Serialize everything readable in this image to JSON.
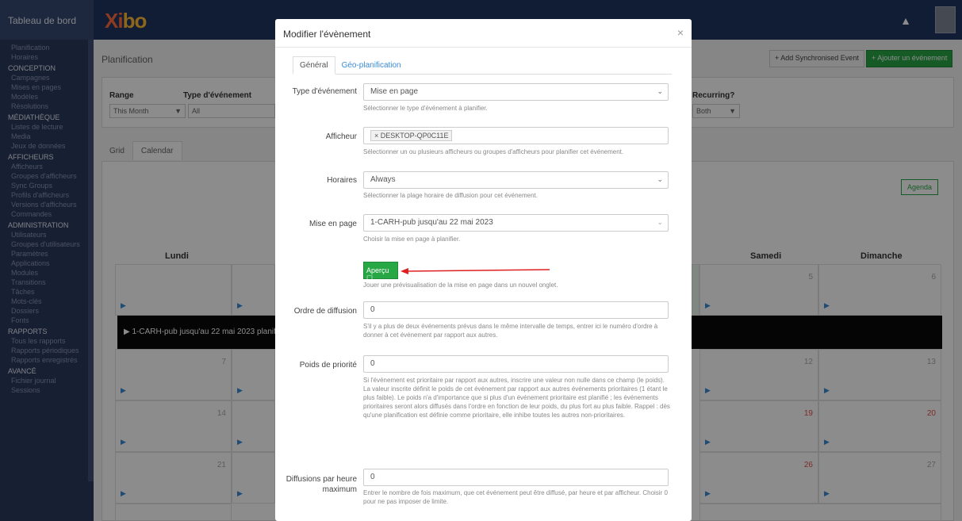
{
  "sidebar": {
    "brand": "Tableau de bord",
    "top_items": [
      "Planification",
      "Horaires"
    ],
    "sections": [
      {
        "title": "CONCEPTION",
        "items": [
          "Campagnes",
          "Mises en pages",
          "Modèles",
          "Résolutions"
        ]
      },
      {
        "title": "MÉDIATHÈQUE",
        "items": [
          "Listes de lecture",
          "Media",
          "Jeux de données"
        ]
      },
      {
        "title": "AFFICHEURS",
        "items": [
          "Afficheurs",
          "Groupes d'afficheurs",
          "Sync Groups",
          "Profils d'afficheurs",
          "Versions d'afficheurs",
          "Commandes"
        ]
      },
      {
        "title": "ADMINISTRATION",
        "items": [
          "Utilisateurs",
          "Groupes d'utilisateurs",
          "Paramètres",
          "Applications",
          "Modules",
          "Transitions",
          "Tâches",
          "Mots-clés",
          "Dossiers",
          "Fonts"
        ]
      },
      {
        "title": "RAPPORTS",
        "items": [
          "Tous les rapports",
          "Rapports périodiques",
          "Rapports enregistrés"
        ]
      },
      {
        "title": "AVANCÉ",
        "items": [
          "Fichier journal",
          "Sessions"
        ]
      }
    ]
  },
  "topbar": {
    "logo_a": "Xi",
    "logo_b": "bo",
    "bell_icon": "bell-icon",
    "avatar_icon": "user-avatar"
  },
  "page": {
    "title": "Planification",
    "sync_button": "+ Add Synchronised Event",
    "add_button": "+ Ajouter un événement",
    "filters": {
      "range_label": "Range",
      "range_value": "This Month",
      "type_label": "Type d'événement",
      "type_value": "All",
      "recurring_label": "Recurring?",
      "recurring_value": "Both"
    },
    "view_tabs": [
      "Grid",
      "Calendar"
    ],
    "agenda_button": "Agenda",
    "day_headers": {
      "mon": "Lundi",
      "sat": "Samedi",
      "sun": "Dimanche"
    },
    "dates": {
      "r1_sat": "5",
      "r1_sun": "6",
      "r2_mon": "7",
      "r2_sat": "12",
      "r2_sun": "13",
      "r3_mon": "14",
      "r3_sat": "19",
      "r3_sun": "20",
      "r4_mon": "21",
      "r4_sat": "26",
      "r4_sun": "27"
    },
    "event_bar": "1-CARH-pub jusqu'au 22 mai 2023 planif"
  },
  "modal": {
    "title": "Modifier l'évènement",
    "close_icon": "×",
    "tabs": [
      "Général",
      "Géo-planification"
    ],
    "fields": {
      "type": {
        "label": "Type d'événement",
        "value": "Mise en page",
        "help": "Sélectionner le type d'événement à planifier."
      },
      "display": {
        "label": "Afficheur",
        "tag": "× DESKTOP-QP0C11E",
        "help": "Sélectionner un ou plusieurs afficheurs ou groupes d'afficheurs pour planifier cet événement."
      },
      "dayparting": {
        "label": "Horaires",
        "value": "Always",
        "help": "Sélectionner la plage horaire de diffusion pour cet événement."
      },
      "layout": {
        "label": "Mise en page",
        "value": "1-CARH-pub jusqu'au 22 mai 2023",
        "help": "Choisir la mise en page à planifier."
      },
      "preview": {
        "button": "Aperçu ☐",
        "help": "Jouer une prévisualisation de la mise en page dans un nouvel onglet."
      },
      "display_order": {
        "label": "Ordre de diffusion",
        "value": "0",
        "help": "S'il y a plus de deux événements prévus dans le même intervalle de temps, entrer ici le numéro d'ordre à donner à cet événement par rapport aux autres."
      },
      "priority": {
        "label": "Poids de priorité",
        "value": "0",
        "help": "Si l'événement est prioritaire par rapport aux autres, inscrire une valeur non nulle dans ce champ (le poids). La valeur inscrite définit le poids de cet événement par rapport aux autres événements prioritaires (1 étant le plus faible). Le poids n'a d'importance que si plus d'un événement prioritaire est planifié ; les événements prioritaires seront alors diffusés dans l'ordre en fonction de leur poids, du plus fort au plus faible. Rappel : dès qu'une planification est définie comme prioritaire, elle inhibe toutes les autres non-prioritaires."
      },
      "max_plays": {
        "label": "Diffusions par heure maximum",
        "value": "0",
        "help": "Entrer le nombre de fois maximum, que cet événement peut être diffusé, par heure et par afficheur. Choisir 0 pour ne pas imposer de limite."
      }
    }
  },
  "colors": {
    "sidebar": "#2a3a5e",
    "topbar": "#1f3461",
    "accent_green": "#28a745",
    "link_blue": "#3a8ad6",
    "arrow_red": "#e02020"
  }
}
